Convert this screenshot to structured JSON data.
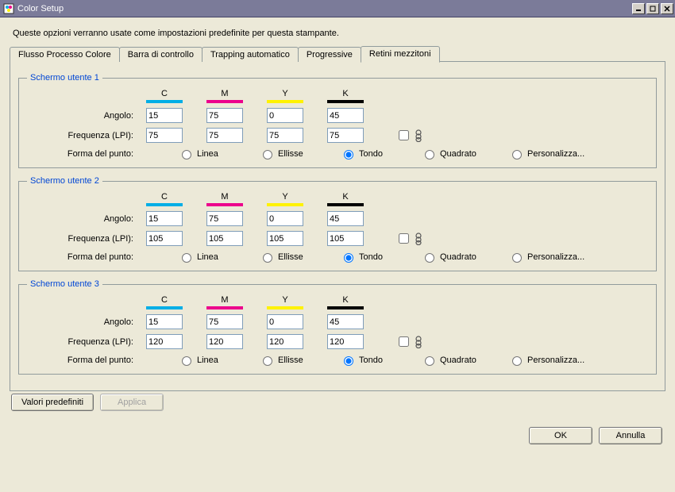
{
  "window": {
    "title": "Color Setup"
  },
  "description": "Queste opzioni verranno usate come impostazioni predefinite per questa stampante.",
  "tabs": {
    "t0": "Flusso Processo Colore",
    "t1": "Barra di controllo",
    "t2": "Trapping automatico",
    "t3": "Progressive",
    "t4": "Retini mezzitoni"
  },
  "columns": {
    "c": "C",
    "m": "M",
    "y": "Y",
    "k": "K"
  },
  "colors": {
    "c": "#00aee6",
    "m": "#ec008c",
    "y": "#fff200",
    "k": "#000000"
  },
  "labels": {
    "angle": "Angolo:",
    "frequency": "Frequenza (LPI):",
    "dotshape": "Forma del punto:"
  },
  "radios": {
    "line": "Linea",
    "ellipse": "Ellisse",
    "round": "Tondo",
    "square": "Quadrato",
    "custom": "Personalizza..."
  },
  "screens": [
    {
      "title": "Schermo utente 1",
      "angle": {
        "c": "15",
        "m": "75",
        "y": "0",
        "k": "45"
      },
      "freq": {
        "c": "75",
        "m": "75",
        "y": "75",
        "k": "75"
      },
      "linked": false,
      "shape": "round"
    },
    {
      "title": "Schermo utente 2",
      "angle": {
        "c": "15",
        "m": "75",
        "y": "0",
        "k": "45"
      },
      "freq": {
        "c": "105",
        "m": "105",
        "y": "105",
        "k": "105"
      },
      "linked": false,
      "shape": "round"
    },
    {
      "title": "Schermo utente 3",
      "angle": {
        "c": "15",
        "m": "75",
        "y": "0",
        "k": "45"
      },
      "freq": {
        "c": "120",
        "m": "120",
        "y": "120",
        "k": "120"
      },
      "linked": false,
      "shape": "round"
    }
  ],
  "buttons": {
    "defaults": "Valori predefiniti",
    "apply": "Applica",
    "ok": "OK",
    "cancel": "Annulla"
  }
}
